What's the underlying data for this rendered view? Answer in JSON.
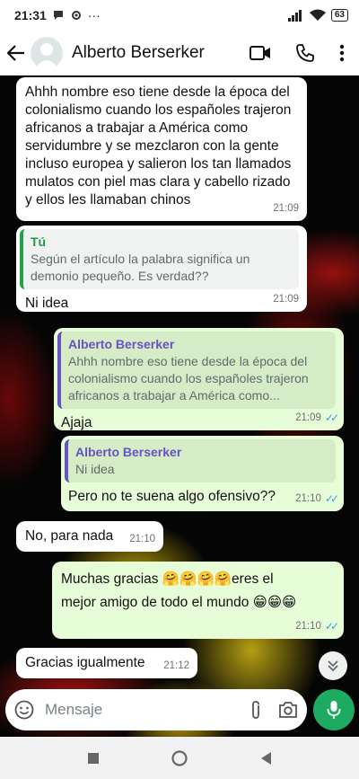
{
  "status": {
    "time": "21:31",
    "battery": "63"
  },
  "header": {
    "contact_name": "Alberto Berserker"
  },
  "messages": [
    {
      "dir": "in",
      "text": "Ahhh nombre eso tiene desde la época del colonialismo cuando los españoles trajeron africanos a trabajar a América como servidumbre y se mezclaron con la gente incluso europea y salieron los tan llamados mulatos con piel mas clara y cabello rizado y ellos les llamaban chinos",
      "time": "21:09"
    },
    {
      "dir": "in",
      "quote_name": "Tú",
      "quote_text": "Según el artículo la palabra significa un demonio pequeño. Es verdad??",
      "text": "Ni idea",
      "time": "21:09"
    },
    {
      "dir": "out",
      "quote_name": "Alberto Berserker",
      "quote_text": "Ahhh nombre eso tiene desde la época del colonialismo cuando los españoles trajeron africanos a trabajar a América como...",
      "text": "Ajaja",
      "time": "21:09"
    },
    {
      "dir": "out",
      "quote_name": "Alberto Berserker",
      "quote_text": "Ni idea",
      "text": "Pero no te suena algo ofensivo??",
      "time": "21:10"
    },
    {
      "dir": "in",
      "text": "No, para nada",
      "time": "21:10"
    },
    {
      "dir": "out",
      "text": "Muchas gracias 🤗🤗🤗🤗eres el mejor amigo de todo el mundo 😁😁😁",
      "time": "21:10"
    },
    {
      "dir": "in",
      "text": "Gracias igualmente",
      "time": "21:12"
    }
  ],
  "input": {
    "placeholder": "Mensaje"
  },
  "icons": {
    "back": "arrow-left-icon",
    "video": "video-call-icon",
    "call": "phone-icon",
    "menu": "more-vert-icon",
    "emoji": "emoji-icon",
    "attach": "paperclip-icon",
    "camera": "camera-icon",
    "mic": "mic-icon",
    "scroll": "chevron-double-down-icon"
  },
  "colors": {
    "outgoing_bubble": "#e7fdd7",
    "incoming_bubble": "#ffffff",
    "accent": "#1daa61",
    "read_ticks": "#3a9fe6"
  }
}
